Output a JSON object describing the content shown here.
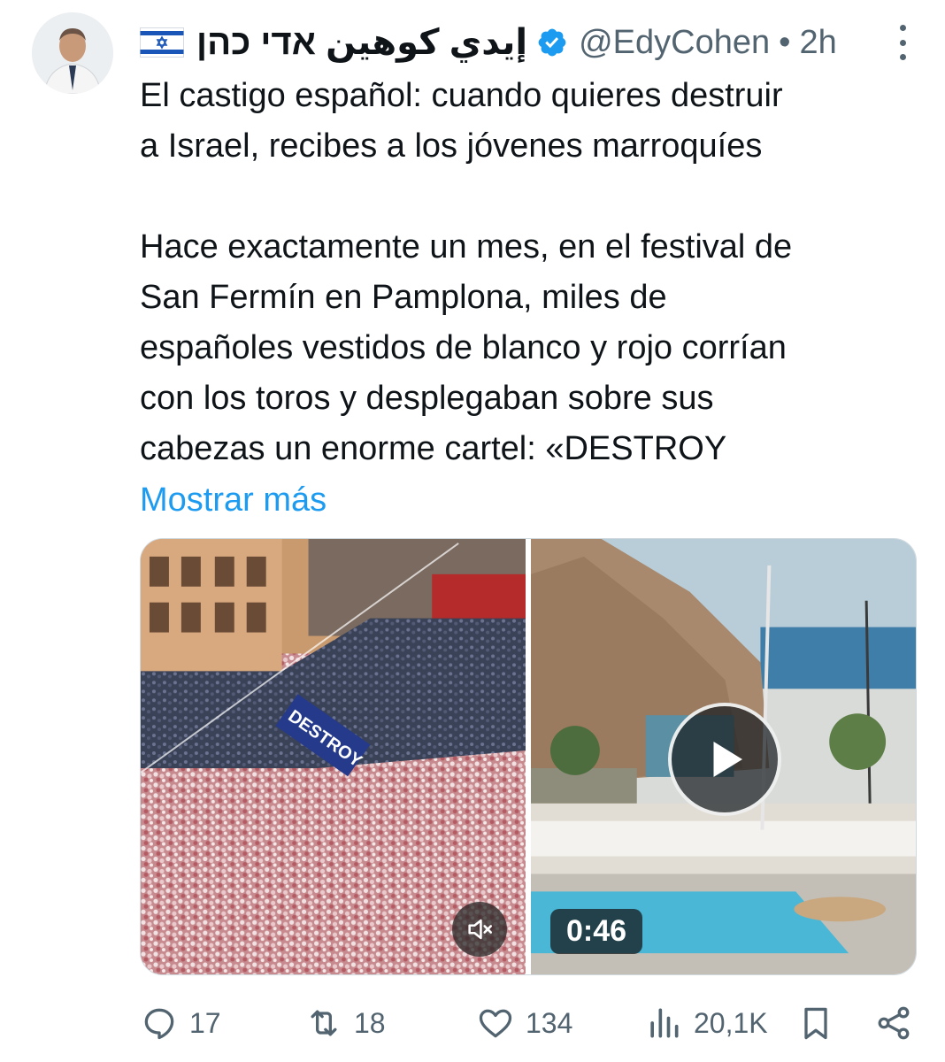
{
  "tweet": {
    "author": {
      "display_name": "إيدي كوهين אדי כהן",
      "handle": "@EdyCohen",
      "separator": "•",
      "time": "2h",
      "flag_icon": "israel-flag-icon",
      "verified_icon": "verified-badge-icon"
    },
    "text": {
      "line1": "El castigo español: cuando quieres destruir",
      "line2": "a Israel, recibes a los jóvenes marroquíes",
      "line3": "Hace exactamente un mes, en el festival de",
      "line4": "San Fermín en Pamplona, miles de",
      "line5": "españoles vestidos de blanco y rojo corrían",
      "line6": "con los toros y desplegaban sobre sus",
      "line7": "cabezas un enorme cartel: «DESTROY"
    },
    "show_more": "Mostrar más",
    "media": {
      "left_video": {
        "banner_text": "DESTROY",
        "mute_icon": "speaker-muted-icon"
      },
      "right_video": {
        "duration": "0:46",
        "play_icon": "play-icon"
      }
    },
    "actions": {
      "replies": "17",
      "retweets": "18",
      "likes": "134",
      "views": "20,1K"
    }
  },
  "colors": {
    "text": "#0f1419",
    "secondary": "#536471",
    "link": "#1d9bf0",
    "verified": "#1d9bf0"
  }
}
